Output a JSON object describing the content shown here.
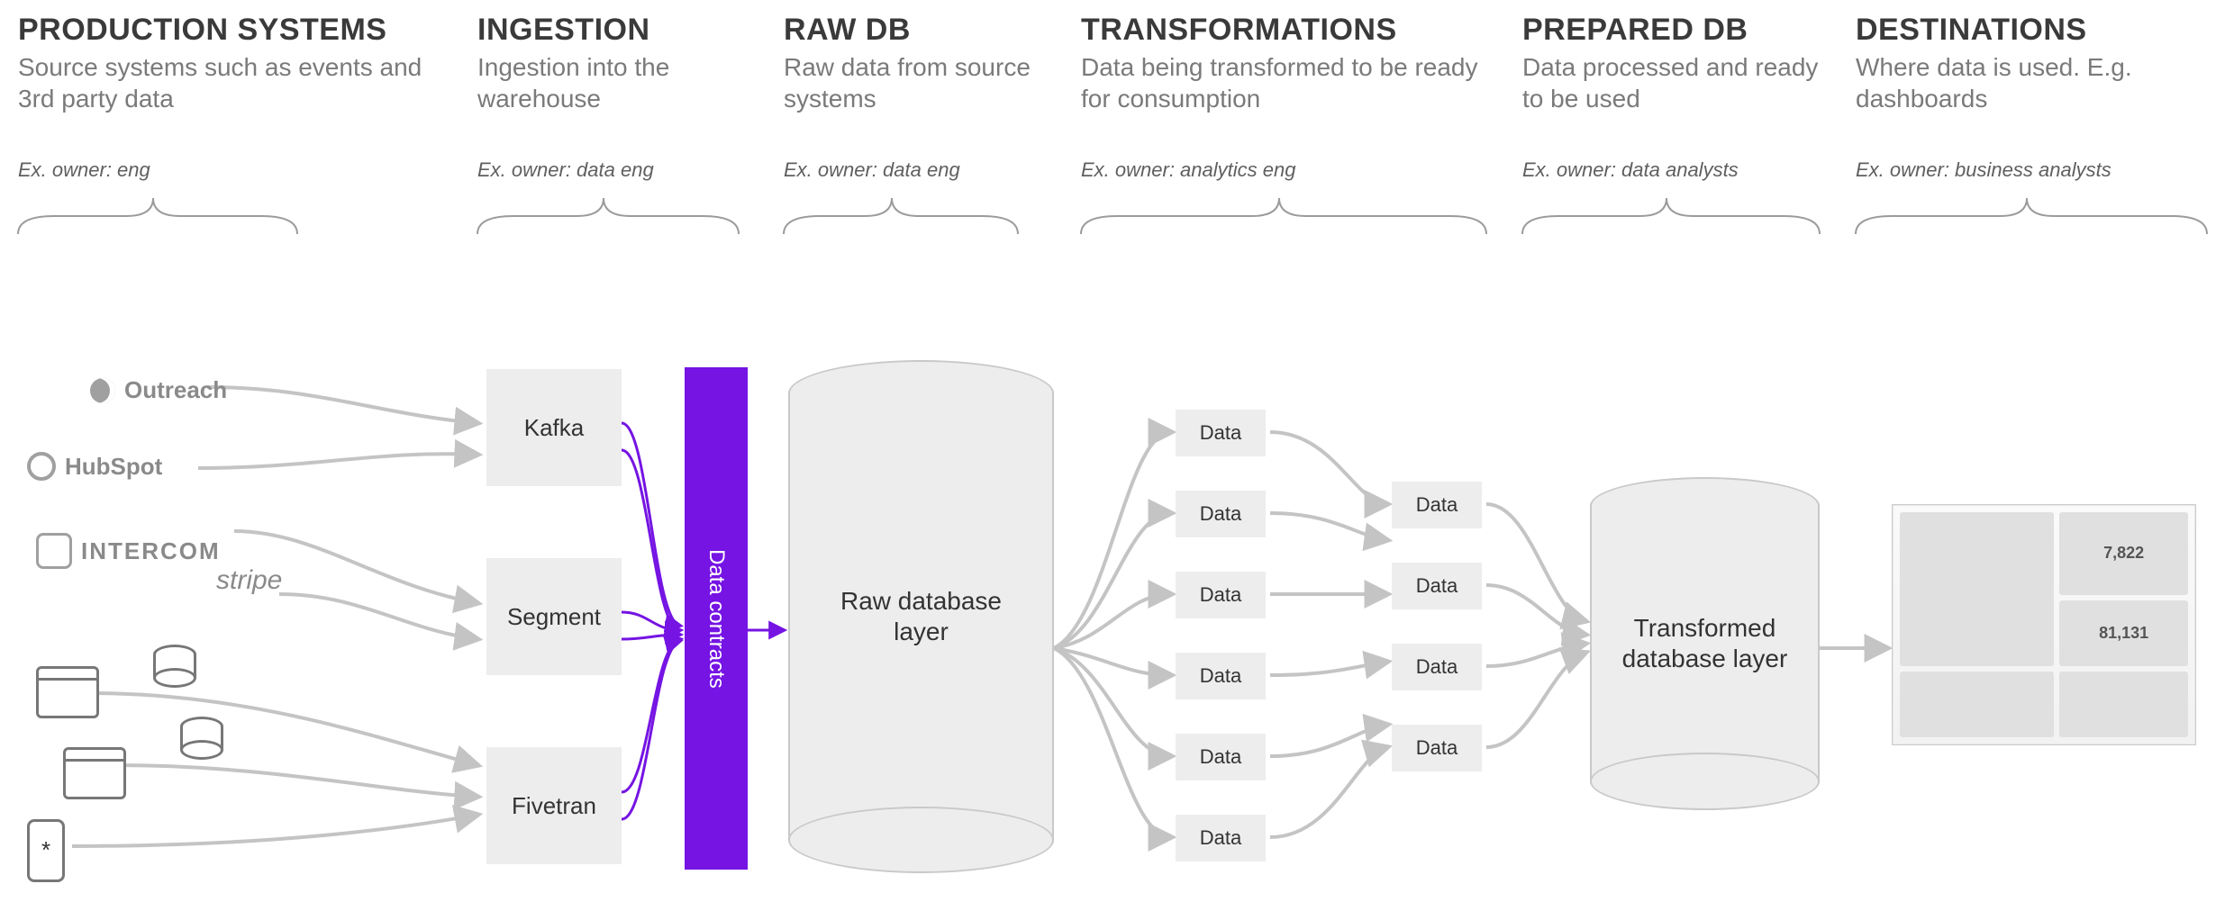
{
  "columns": [
    {
      "title": "PRODUCTION SYSTEMS",
      "subtitle": "Source systems such as events and 3rd party data",
      "owner": "Ex. owner: eng"
    },
    {
      "title": "INGESTION",
      "subtitle": "Ingestion into the warehouse",
      "owner": "Ex. owner: data eng"
    },
    {
      "title": "RAW DB",
      "subtitle": "Raw data from source systems",
      "owner": "Ex. owner: data eng"
    },
    {
      "title": "TRANSFORMATIONS",
      "subtitle": "Data being transformed to be ready for consumption",
      "owner": "Ex. owner: analytics eng"
    },
    {
      "title": "PREPARED DB",
      "subtitle": "Data processed and ready to be used",
      "owner": "Ex. owner: data analysts"
    },
    {
      "title": "DESTINATIONS",
      "subtitle": "Where data is used. E.g. dashboards",
      "owner": "Ex. owner: business analysts"
    }
  ],
  "production_sources": {
    "outreach_label": "Outreach",
    "hubspot_label": "HubSpot",
    "intercom_label": "INTERCOM",
    "stripe_label": "stripe"
  },
  "ingestion_tools": {
    "kafka": "Kafka",
    "segment": "Segment",
    "fivetran": "Fivetran"
  },
  "contracts_label": "Data contracts",
  "raw_db_label": "Raw database layer",
  "prepared_db_label": "Transformed database layer",
  "transform_stage1": [
    "Data",
    "Data",
    "Data",
    "Data",
    "Data",
    "Data"
  ],
  "transform_stage2": [
    "Data",
    "Data",
    "Data",
    "Data"
  ],
  "destination_dashboard": {
    "stat1": "7,822",
    "stat2": "81,131"
  },
  "colors": {
    "purple": "#7514e3",
    "box_grey": "#ededed"
  }
}
